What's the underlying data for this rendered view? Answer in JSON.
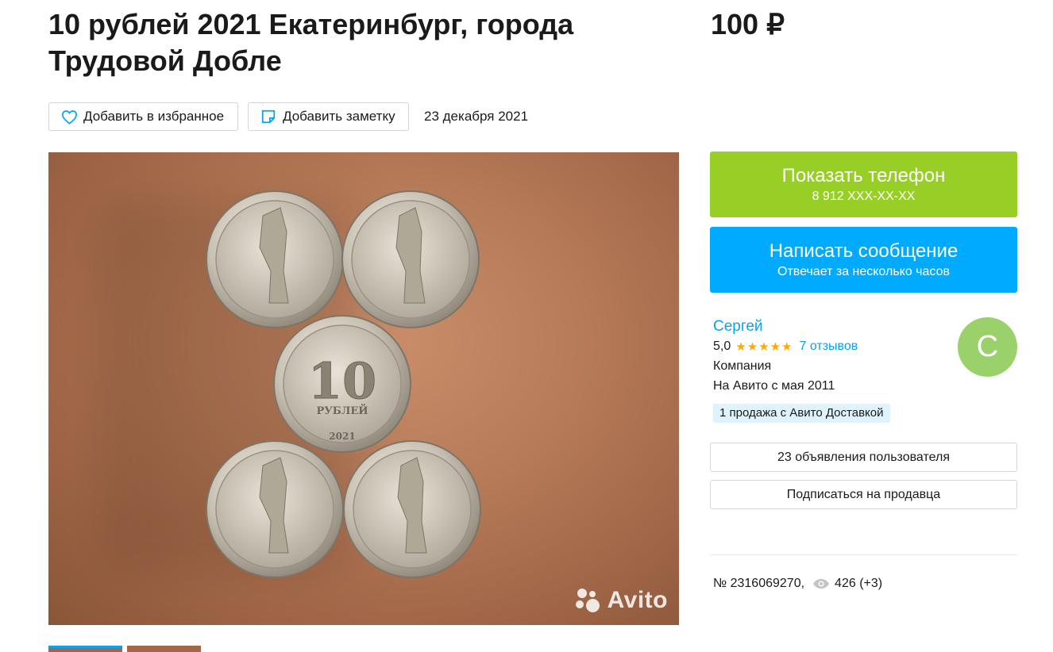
{
  "listing": {
    "title": "10 рублей 2021 Екатеринбург, города Трудовой Добле",
    "price": "100 ₽",
    "date": "23 декабря 2021",
    "number": "№ 2316069270,",
    "views": "426 (+3)"
  },
  "actions": {
    "favorite_label": "Добавить в избранное",
    "note_label": "Добавить заметку"
  },
  "photo": {
    "watermark": "Avito",
    "coin_center_value": "10",
    "coin_center_text": "РУБЛЕЙ",
    "coin_center_year": "2021"
  },
  "contact": {
    "phone_label": "Показать телефон",
    "phone_masked": "8 912 XXX-XX-XX",
    "message_label": "Написать сообщение",
    "message_sub": "Отвечает за несколько часов"
  },
  "seller": {
    "name": "Сергей",
    "rating": "5,0",
    "stars": "★★★★★",
    "reviews": "7 отзывов",
    "type": "Компания",
    "since": "На Авито с мая 2011",
    "badge": "1 продажа с Авито Доставкой",
    "avatar_letter": "С",
    "ads_button": "23 объявления пользователя",
    "subscribe_button": "Подписаться на продавца"
  },
  "colors": {
    "accent_blue": "#00aaff",
    "accent_green": "#97cf26",
    "link": "#0aa2f0",
    "star": "#ffaa00"
  }
}
